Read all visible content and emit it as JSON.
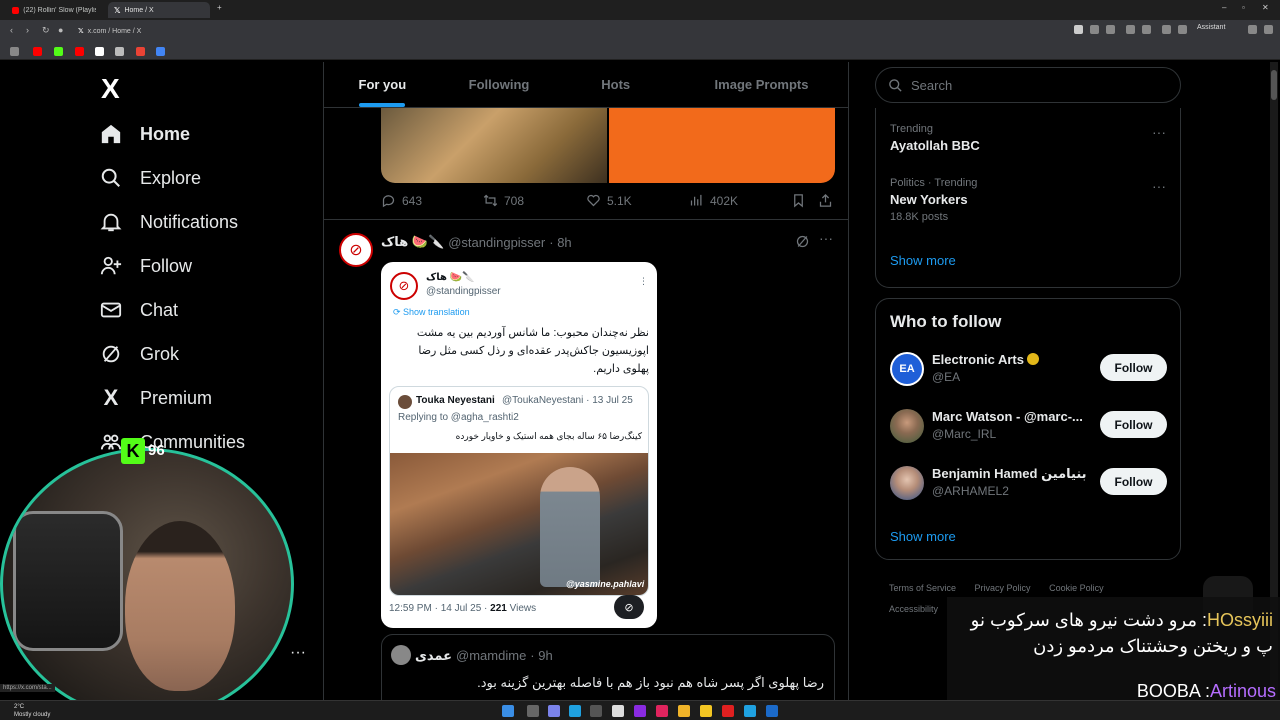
{
  "browser": {
    "tabs": [
      {
        "label": "(22) Rollin' Slow (Playlist) — C",
        "active": false
      },
      {
        "label": "Home / X",
        "active": true
      }
    ],
    "url": "x.com / Home / X",
    "assistant_label": "Assistant"
  },
  "nav": {
    "logo": "X",
    "items": [
      {
        "label": "Home",
        "icon": "home-icon"
      },
      {
        "label": "Explore",
        "icon": "search-icon"
      },
      {
        "label": "Notifications",
        "icon": "bell-icon"
      },
      {
        "label": "Follow",
        "icon": "person-plus-icon"
      },
      {
        "label": "Chat",
        "icon": "mail-icon"
      },
      {
        "label": "Grok",
        "icon": "grok-icon"
      },
      {
        "label": "Premium",
        "icon": "x-icon"
      },
      {
        "label": "Communities",
        "icon": "communities-icon"
      }
    ],
    "more_label": "···"
  },
  "feed": {
    "tabs": [
      "For you",
      "Following",
      "Hots",
      "Image Prompts"
    ],
    "active_tab": "For you",
    "metrics": {
      "replies": "643",
      "reposts": "708",
      "likes": "5.1K",
      "views": "402K"
    },
    "post": {
      "name": "هاک 🍉🔪",
      "handle": "@standingpisser",
      "time": "· 8h",
      "card": {
        "name": "هاک 🍉🔪",
        "handle": "@standingpisser",
        "show_translation": "Show translation",
        "text": "نظر نه‌چندان محبوب: ما شانس آوردیم بین یه مشت اپوزیسیون جاکش‌پدر عقده‌ای و رذل کسی مثل رضا پهلوی داریم.",
        "quote": {
          "name": "Touka Neyestani",
          "meta": "@ToukaNeyestani · 13 Jul 25",
          "replying": "Replying to @agha_rashti2",
          "text": "کینگ‌رضا ۶۵ ساله بجای همه استیک و خاویار خورده",
          "credit": "@yasmine.pahlavi"
        },
        "footer_time": "12:59 PM · 14 Jul 25 · ",
        "footer_views": "221",
        "footer_views_label": " Views"
      }
    },
    "reply": {
      "name": "عمدی",
      "handle": "@mamdime",
      "time": "· 9h",
      "text": "رضا پهلوی اگر پسر شاه هم نبود باز هم با فاصله بهترین گزینه بود."
    }
  },
  "sidebar": {
    "search_placeholder": "Search",
    "trends": [
      {
        "context": "Trending",
        "title": "Ayatollah BBC",
        "count": ""
      },
      {
        "context": "Politics · Trending",
        "title": "New Yorkers",
        "count": "18.8K posts"
      }
    ],
    "show_more": "Show more",
    "who_to_follow_title": "Who to follow",
    "who_to_follow": [
      {
        "name": "Electronic Arts",
        "handle": "@EA",
        "verified": true,
        "button": "Follow"
      },
      {
        "name": "Marc Watson - @marc-...",
        "handle": "@Marc_IRL",
        "verified": false,
        "button": "Follow"
      },
      {
        "name": "Benjamin Hamed بنیامین",
        "handle": "@ARHAMEL2",
        "verified": false,
        "button": "Follow"
      }
    ],
    "footer_links": [
      "Terms of Service",
      "Privacy Policy",
      "Cookie Policy",
      "Accessibility"
    ]
  },
  "overlay": {
    "kick_count": "96",
    "status_url": "https://x.com/sta...",
    "chat": [
      {
        "user": "HOssyiii",
        "message": "مرو دشت نیرو های سرکوب نو پ و ریختن وحشتناک مردمو زدن"
      },
      {
        "user": "Artinous",
        "message": "BOOBA"
      }
    ]
  },
  "taskbar": {
    "weather_temp": "2°C",
    "weather_desc": "Mostly cloudy"
  },
  "colors": {
    "accent": "#1d9bf0",
    "kick_green": "#53fc18",
    "webcam_border": "#27c29a"
  }
}
